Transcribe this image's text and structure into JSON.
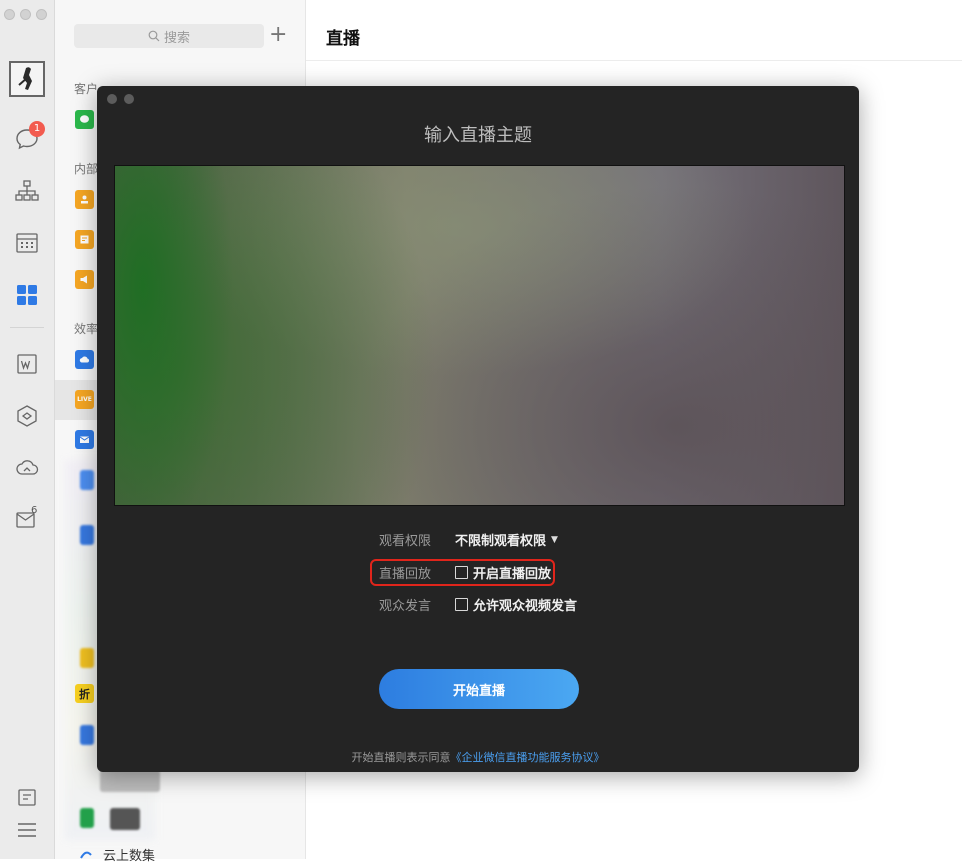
{
  "rail": {
    "unread_badge": "1",
    "mail_superscript": "6"
  },
  "listpanel": {
    "search_placeholder": "搜索",
    "add_label": "+",
    "sections": [
      "客户",
      "内部",
      "效率"
    ],
    "bottom_item": "云上数集",
    "live_icon_text": "LIVE",
    "zhe_icon_text": "折"
  },
  "main": {
    "title": "直播"
  },
  "dialog": {
    "title": "输入直播主题",
    "view_permission_label": "观看权限",
    "view_permission_value": "不限制观看权限",
    "replay_label": "直播回放",
    "replay_option": "开启直播回放",
    "audience_label": "观众发言",
    "audience_option": "允许观众视频发言",
    "start_button": "开始直播",
    "agreement_prefix": "开始直播则表示同意",
    "agreement_link": "《企业微信直播功能服务协议》"
  },
  "colors": {
    "accent_blue": "#2d7de0",
    "highlight_red": "#e0251b",
    "dialog_bg": "#242424",
    "badge_red": "#f25b4f"
  },
  "icons": {
    "rail": [
      "avatar",
      "chat-icon",
      "org-chart-icon",
      "calendar-icon",
      "workbench-grid-icon",
      "doc-icon",
      "apps-cube-icon",
      "cloud-drive-icon",
      "mail-icon",
      "notes-icon",
      "menu-icon"
    ],
    "camera_switch": "camera-switch-icon"
  }
}
